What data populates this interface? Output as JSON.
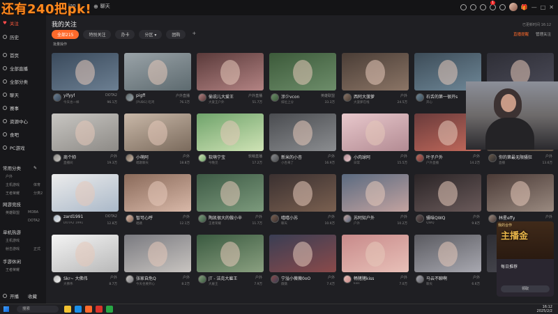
{
  "overlay_caption": "还有240把pk!",
  "topbar": {
    "user_text": "jan",
    "chat_label": "聊天",
    "notify_count": "1"
  },
  "sidebar": {
    "follow": "关注",
    "history": "历史",
    "home": "首页",
    "all_live": "全部直播",
    "all_categories": "全部分类",
    "chat": "聊天",
    "events": "赛事",
    "resources": "资源中心",
    "mobile": "食吧",
    "pc_games": "PC游戏",
    "common_cats": "常用分类",
    "sub1": [
      "户外",
      "主机游戏",
      "体育"
    ],
    "sub2": [
      "王者荣耀",
      "分类2"
    ],
    "online_games": "网游竞技",
    "sub3": [
      "英雄联盟",
      "MOBA"
    ],
    "sub4": [
      "DOTA2"
    ],
    "single": "单机热游",
    "sub5": [
      "主机游戏"
    ],
    "sub6": [
      "射击游戏",
      "正式"
    ],
    "mobile_games": "手游休闲",
    "sub7": [
      "王者荣耀"
    ],
    "open_label": "开播",
    "bottom_right": "收藏"
  },
  "main": {
    "title": "我的关注",
    "filters": [
      {
        "label": "全部215",
        "active": true
      },
      {
        "label": "特别关注",
        "active": false
      },
      {
        "label": "办卡",
        "active": false
      },
      {
        "label": "分区 ▾",
        "active": false
      },
      {
        "label": "团购",
        "active": false
      }
    ],
    "filter_add": "+",
    "bulk_action": "批量操作",
    "top_info": "已更新时间 16:12",
    "link_live": "直播提醒",
    "link_manage": "管理关注"
  },
  "cards": [
    {
      "name": "yifyyf",
      "cat": "DOTA2",
      "sub": "今天也一样",
      "heat": "96.1万"
    },
    {
      "name": "pigff",
      "cat": "户外直播",
      "sub": "[PUBG] 吃鸡",
      "heat": "76.1万"
    },
    {
      "name": "偷说儿大爱王",
      "cat": "户外直播",
      "sub": "大爱王户外",
      "heat": "51.7万"
    },
    {
      "name": "涉少vcon",
      "cat": "英雄联盟",
      "sub": "排位上分",
      "heat": "33.3万"
    },
    {
      "name": "西阿大菠萝",
      "cat": "户外",
      "sub": "大菠萝在线",
      "heat": "24.5万"
    },
    {
      "name": "石舌的第一很开s",
      "cat": "户外",
      "sub": "开心",
      "heat": "20.1万"
    },
    {
      "name": "",
      "cat": "",
      "sub": "",
      "heat": ""
    },
    {
      "name": "商个帅",
      "cat": "户外",
      "sub": "直播间",
      "heat": "19.3万"
    },
    {
      "name": "小萌阿",
      "cat": "户外",
      "sub": "唱歌聊天",
      "heat": "18.8万"
    },
    {
      "name": "软萌宁宝",
      "cat": "软萌直播",
      "sub": "今晚见",
      "heat": "17.2万"
    },
    {
      "name": "新米的小杏",
      "cat": "户外",
      "sub": "小杏来了",
      "heat": "16.9万"
    },
    {
      "name": "小肉球阿",
      "cat": "户外",
      "sub": "日常",
      "heat": "15.5万"
    },
    {
      "name": "叶子户外",
      "cat": "户外",
      "sub": "户外直播",
      "heat": "14.2万"
    },
    {
      "name": "你的第最无限骚狂",
      "cat": "户外",
      "sub": "直播",
      "heat": "13.6万"
    },
    {
      "name": "zard1991",
      "cat": "DOTA2",
      "sub": "DOTA2 1991",
      "heat": "12.8万"
    },
    {
      "name": "智可心呼",
      "cat": "户外",
      "sub": "唱跳",
      "heat": "12.1万"
    },
    {
      "name": "陶凯很大的做小辛",
      "cat": "户外",
      "sub": "王者荣耀",
      "heat": "11.7万"
    },
    {
      "name": "嘻嘻小苏",
      "cat": "户外",
      "sub": "聊天",
      "heat": "10.9万"
    },
    {
      "name": "苏阿知户外",
      "cat": "户外",
      "sub": "户外",
      "heat": "10.2万"
    },
    {
      "name": "骚味QWQ",
      "cat": "户外",
      "sub": "QWQ",
      "heat": "9.8万"
    },
    {
      "name": "林星effy",
      "cat": "户外",
      "sub": "effy",
      "heat": "9.1万"
    },
    {
      "name": "Skr~ 大佛伟",
      "cat": "户外",
      "sub": "大佛伟",
      "heat": "8.7万"
    },
    {
      "name": "张家自危Q",
      "cat": "户外",
      "sub": "今天也要开心",
      "heat": "8.2万"
    },
    {
      "name": "JT - 洁克大雇王",
      "cat": "户外",
      "sub": "大雇王",
      "heat": "7.9万"
    },
    {
      "name": "宁溢小薇薇0oO",
      "cat": "户外",
      "sub": "薇薇",
      "heat": "7.4万"
    },
    {
      "name": "畅猪猪kiss",
      "cat": "户外",
      "sub": "kiss",
      "heat": "7.0万"
    },
    {
      "name": "马云不聊啊",
      "cat": "户外",
      "sub": "聊天",
      "heat": "6.6万"
    },
    {
      "name": "",
      "cat": "",
      "sub": "",
      "heat": ""
    }
  ],
  "promo": {
    "tag": "我的合作",
    "gold_text": "主播金",
    "title": "每日推荐",
    "button": "领取"
  },
  "taskbar": {
    "search": "搜索",
    "time": "16:12",
    "date": "2025/2/2"
  }
}
